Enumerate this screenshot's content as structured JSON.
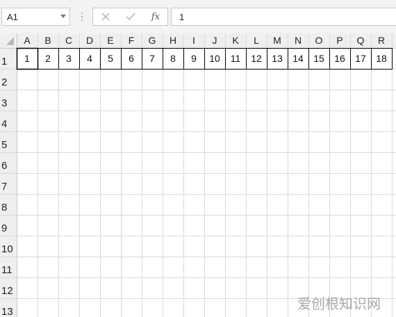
{
  "namebox": {
    "value": "A1"
  },
  "formula_bar": {
    "cancel_icon": "close-icon",
    "enter_icon": "check-icon",
    "function_label": "fx",
    "value": "1"
  },
  "columns": [
    "A",
    "B",
    "C",
    "D",
    "E",
    "F",
    "G",
    "H",
    "I",
    "J",
    "K",
    "L",
    "M",
    "N",
    "O",
    "P",
    "Q",
    "R"
  ],
  "rows": [
    "1",
    "2",
    "3",
    "4",
    "5",
    "6",
    "7",
    "8",
    "9",
    "10",
    "11",
    "12",
    "13"
  ],
  "row1_values": [
    "1",
    "2",
    "3",
    "4",
    "5",
    "6",
    "7",
    "8",
    "9",
    "10",
    "11",
    "12",
    "13",
    "14",
    "15",
    "16",
    "17",
    "18"
  ],
  "watermark": "爱创根知识网",
  "colors": {
    "grid": "#d9d9d9",
    "header_bg": "#efefef",
    "cell_border_dark": "#000000",
    "selected_header": "#e0e0e0"
  }
}
